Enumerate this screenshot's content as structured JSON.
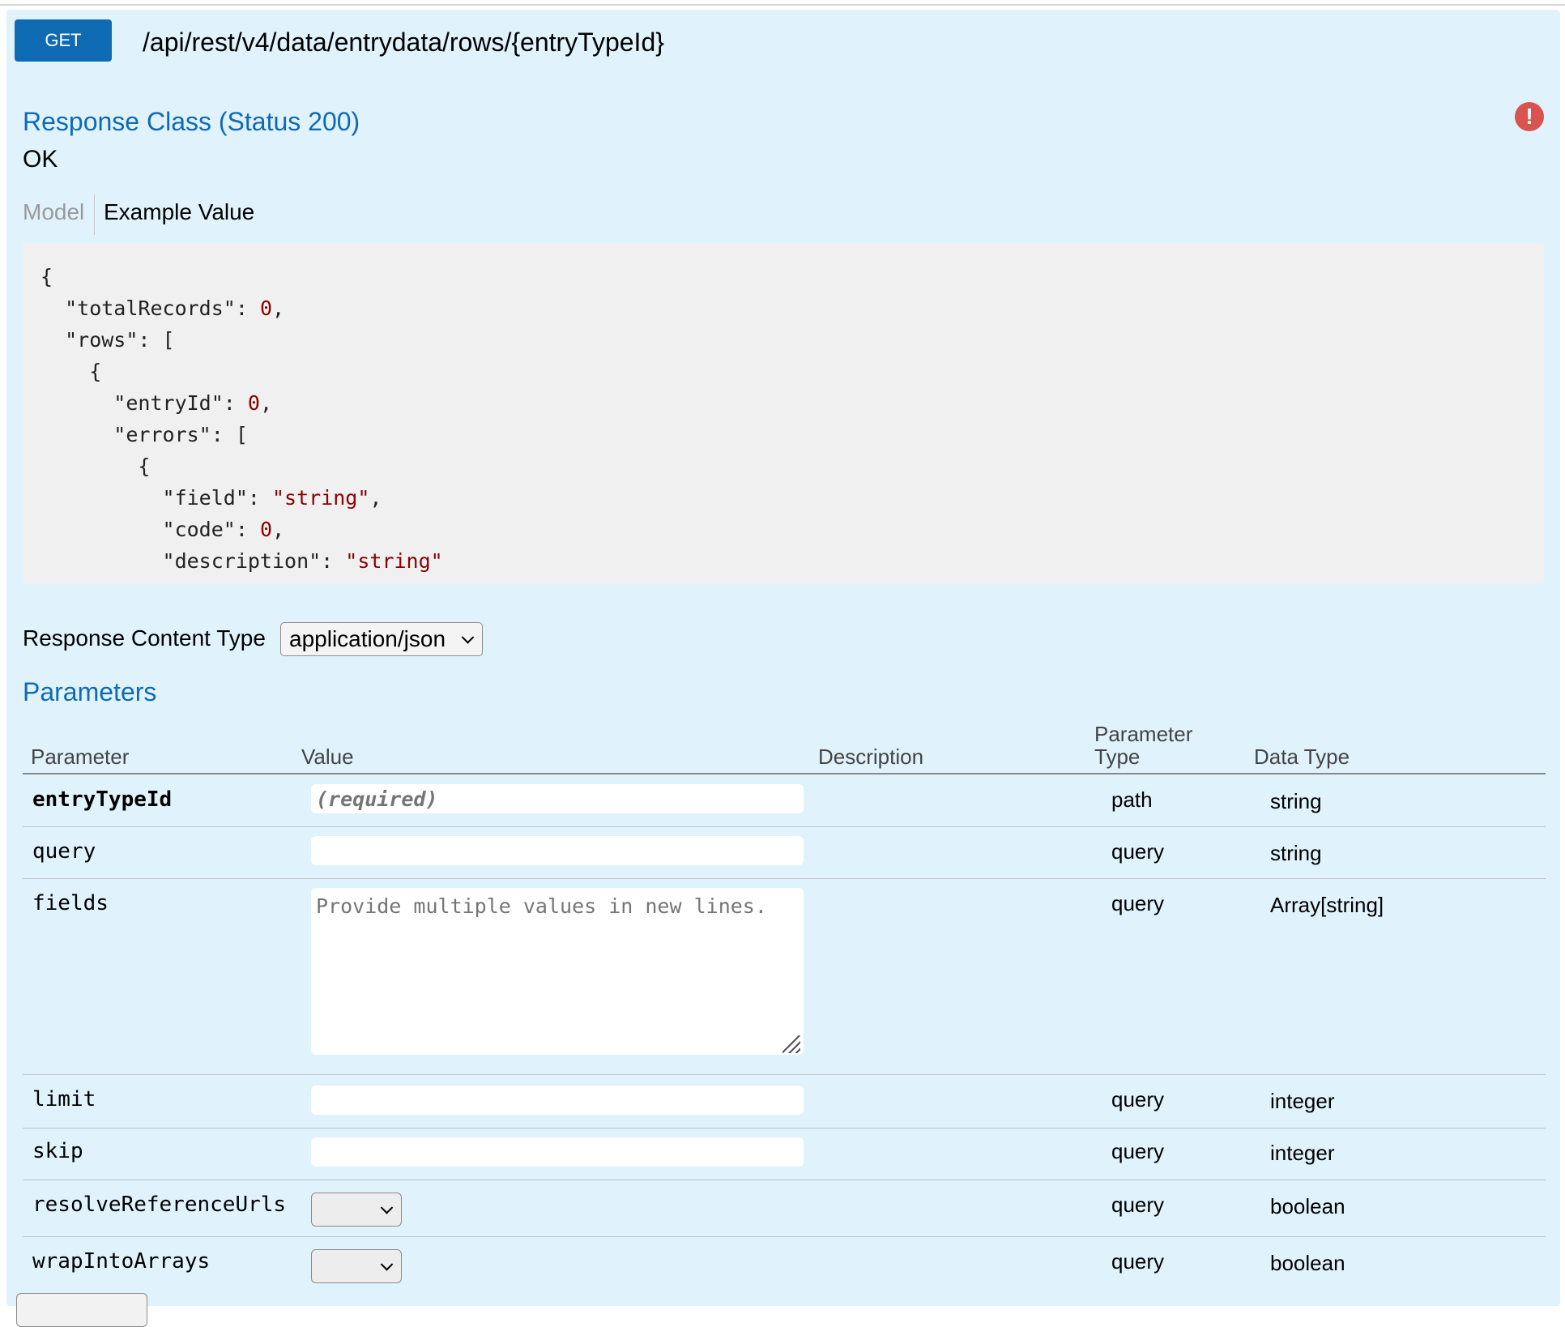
{
  "operation": {
    "method": "GET",
    "path": "/api/rest/v4/data/entrydata/rows/{entryTypeId}"
  },
  "response": {
    "title": "Response Class (Status 200)",
    "status_text": "OK",
    "tabs": {
      "model": "Model",
      "example": "Example Value"
    },
    "example_json": [
      "{",
      "  \"totalRecords\": 0,",
      "  \"rows\": [",
      "    {",
      "      \"entryId\": 0,",
      "      \"errors\": [",
      "        {",
      "          \"field\": \"string\",",
      "          \"code\": 0,",
      "          \"description\": \"string\""
    ],
    "content_type_label": "Response Content Type",
    "content_type_value": "application/json"
  },
  "parameters": {
    "title": "Parameters",
    "headers": {
      "parameter": "Parameter",
      "value": "Value",
      "description": "Description",
      "param_type_1": "Parameter",
      "param_type_2": "Type",
      "data_type": "Data Type"
    },
    "rows": [
      {
        "name": "entryTypeId",
        "placeholder": "(required)",
        "param_type": "path",
        "data_type": "string"
      },
      {
        "name": "query",
        "placeholder": "",
        "param_type": "query",
        "data_type": "string"
      },
      {
        "name": "fields",
        "placeholder": "Provide multiple values in new lines.",
        "param_type": "query",
        "data_type": "Array[string]"
      },
      {
        "name": "limit",
        "placeholder": "",
        "param_type": "query",
        "data_type": "integer"
      },
      {
        "name": "skip",
        "placeholder": "",
        "param_type": "query",
        "data_type": "integer"
      },
      {
        "name": "resolveReferenceUrls",
        "selected": "",
        "param_type": "query",
        "data_type": "boolean"
      },
      {
        "name": "wrapIntoArrays",
        "selected": "",
        "param_type": "query",
        "data_type": "boolean"
      }
    ]
  },
  "icons": {
    "error": "exclamation-circle-icon",
    "dropdown": "chevron-down-icon",
    "resize": "resize-grip-icon"
  },
  "colors": {
    "method_bg": "#0f6ab4",
    "panel_bg": "#e0f3fd",
    "title": "#0f6ab4",
    "json_value": "#8b0000",
    "error_icon": "#d9534f"
  }
}
